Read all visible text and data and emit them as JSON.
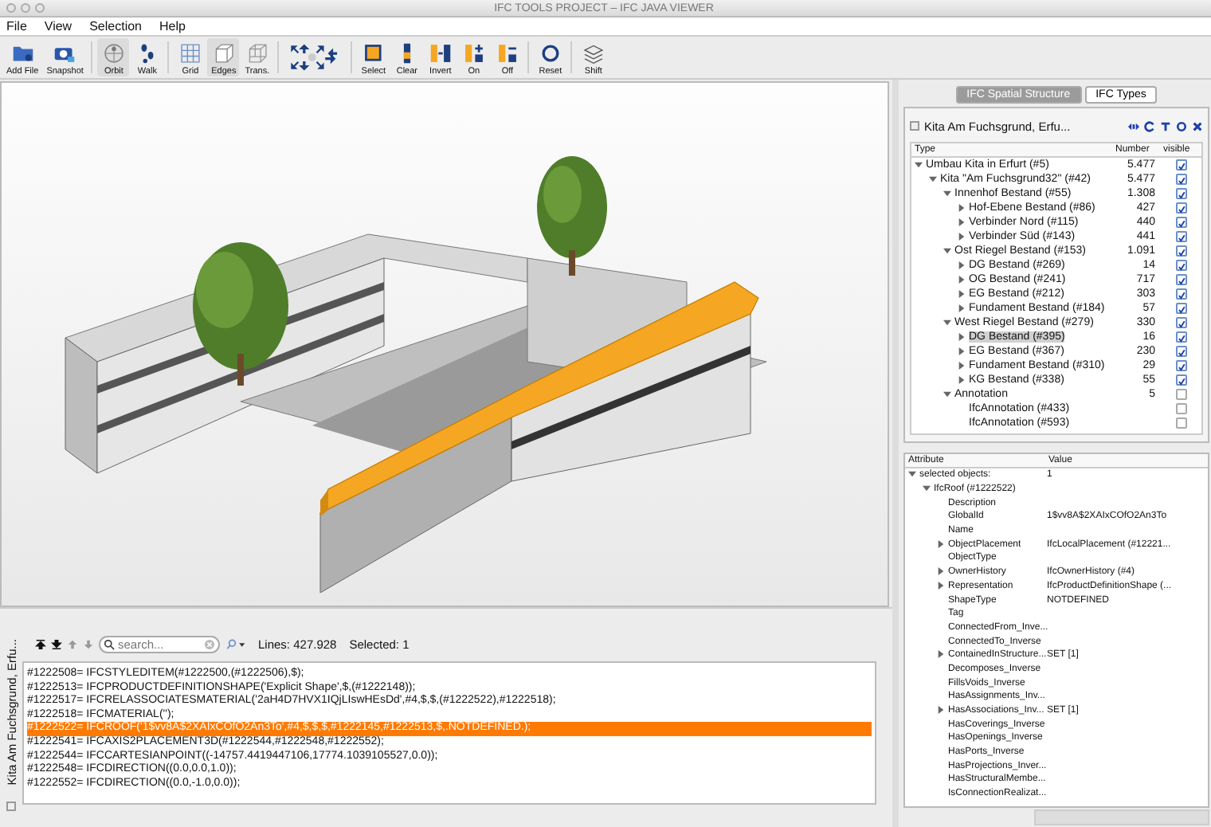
{
  "window": {
    "title": "IFC TOOLS PROJECT – IFC JAVA VIEWER"
  },
  "menu": [
    "File",
    "View",
    "Selection",
    "Help"
  ],
  "toolbar": [
    {
      "kind": "button",
      "label": "Add File"
    },
    {
      "kind": "button",
      "label": "Snapshot"
    },
    {
      "kind": "separator"
    },
    {
      "kind": "button",
      "label": "Orbit",
      "selected": true
    },
    {
      "kind": "button",
      "label": "Walk",
      "selected": false
    },
    {
      "kind": "separator"
    },
    {
      "kind": "button",
      "label": "Grid",
      "selected": false
    },
    {
      "kind": "button",
      "label": "Edges",
      "selected": true
    },
    {
      "kind": "button",
      "label": "Trans.",
      "selected": false
    },
    {
      "kind": "separator"
    },
    {
      "kind": "nav"
    },
    {
      "kind": "separator"
    },
    {
      "kind": "button",
      "label": "Select"
    },
    {
      "kind": "button",
      "label": "Clear"
    },
    {
      "kind": "button",
      "label": "Invert"
    },
    {
      "kind": "button",
      "label": "On"
    },
    {
      "kind": "button",
      "label": "Off"
    },
    {
      "kind": "separator"
    },
    {
      "kind": "button",
      "label": "Reset"
    },
    {
      "kind": "separator"
    },
    {
      "kind": "button",
      "label": "Shift"
    }
  ],
  "bottom_panel": {
    "side_tab": "Kita Am Fuchsgrund, Erfu...",
    "side_tab_checked": false,
    "search": {
      "placeholder": "search..."
    },
    "lines_label": "Lines: 427.928",
    "selected_label": "Selected: 1",
    "lines": [
      {
        "text": "#1222508= IFCSTYLEDITEM(#1222500,(#1222506),$);",
        "selected": false
      },
      {
        "text": "#1222513= IFCPRODUCTDEFINITIONSHAPE('Explicit Shape',$,(#1222148));",
        "selected": false
      },
      {
        "text": "#1222517= IFCRELASSOCIATESMATERIAL('2aH4D7HVX1IQjLIswHEsDd',#4,$,$,(#1222522),#1222518);",
        "selected": false
      },
      {
        "text": "#1222518= IFCMATERIAL('');",
        "selected": false
      },
      {
        "text": "#1222522= IFCROOF('1$vv8A$2XAIxCOfO2An3To',#4,$,$,$,#1222145,#1222513,$,.NOTDEFINED.);",
        "selected": true
      },
      {
        "text": "#1222541= IFCAXIS2PLACEMENT3D(#1222544,#1222548,#1222552);",
        "selected": false
      },
      {
        "text": "#1222544= IFCCARTESIANPOINT((-14757.4419447106,17774.1039105527,0.0));",
        "selected": false
      },
      {
        "text": "#1222548= IFCDIRECTION((0.0,0.0,1.0));",
        "selected": false
      },
      {
        "text": "#1222552= IFCDIRECTION((0.0,-1.0,0.0));",
        "selected": false
      }
    ]
  },
  "spatial_panel": {
    "tabs": [
      {
        "label": "IFC Spatial Structure",
        "selected": true
      },
      {
        "label": "IFC Types",
        "selected": false
      }
    ],
    "project": "Kita Am Fuchsgrund, Erfu...",
    "project_checked": false,
    "columns": [
      "Type",
      "Number",
      "visible"
    ],
    "tree": [
      {
        "label": "Umbau Kita in Erfurt (#5)",
        "number": "5.477",
        "visible": true,
        "expanded": true,
        "selected": false,
        "children": [
          {
            "label": "Kita \"Am Fuchsgrund32\" (#42)",
            "number": "5.477",
            "visible": true,
            "expanded": true,
            "selected": false,
            "children": [
              {
                "label": "Innenhof Bestand (#55)",
                "number": "1.308",
                "visible": true,
                "expanded": true,
                "selected": false,
                "children": [
                  {
                    "label": "Hof-Ebene Bestand (#86)",
                    "number": "427",
                    "visible": true,
                    "expanded": false,
                    "selected": false
                  },
                  {
                    "label": "Verbinder Nord (#115)",
                    "number": "440",
                    "visible": true,
                    "expanded": false,
                    "selected": false
                  },
                  {
                    "label": "Verbinder Süd (#143)",
                    "number": "441",
                    "visible": true,
                    "expanded": false,
                    "selected": false
                  }
                ]
              },
              {
                "label": "Ost Riegel Bestand (#153)",
                "number": "1.091",
                "visible": true,
                "expanded": true,
                "selected": false,
                "children": [
                  {
                    "label": "DG Bestand (#269)",
                    "number": "14",
                    "visible": true,
                    "expanded": false,
                    "selected": false
                  },
                  {
                    "label": "OG Bestand (#241)",
                    "number": "717",
                    "visible": true,
                    "expanded": false,
                    "selected": false
                  },
                  {
                    "label": "EG Bestand (#212)",
                    "number": "303",
                    "visible": true,
                    "expanded": false,
                    "selected": false
                  },
                  {
                    "label": "Fundament Bestand (#184)",
                    "number": "57",
                    "visible": true,
                    "expanded": false,
                    "selected": false
                  }
                ]
              },
              {
                "label": "West Riegel Bestand (#279)",
                "number": "330",
                "visible": true,
                "expanded": true,
                "selected": false,
                "children": [
                  {
                    "label": "DG Bestand (#395)",
                    "number": "16",
                    "visible": true,
                    "expanded": false,
                    "selected": true
                  },
                  {
                    "label": "EG Bestand (#367)",
                    "number": "230",
                    "visible": true,
                    "expanded": false,
                    "selected": false
                  },
                  {
                    "label": "Fundament Bestand (#310)",
                    "number": "29",
                    "visible": true,
                    "expanded": false,
                    "selected": false
                  },
                  {
                    "label": "KG Bestand (#338)",
                    "number": "55",
                    "visible": true,
                    "expanded": false,
                    "selected": false
                  }
                ]
              },
              {
                "label": "Annotation",
                "number": "5",
                "visible": false,
                "expanded": true,
                "selected": false,
                "children": [
                  {
                    "label": "IfcAnnotation (#433)",
                    "visible": false,
                    "selected": false
                  },
                  {
                    "label": "IfcAnnotation (#593)",
                    "visible": false,
                    "selected": false
                  }
                ]
              }
            ]
          }
        ]
      }
    ]
  },
  "attributes_panel": {
    "columns": [
      "Attribute",
      "Value"
    ],
    "tree": [
      {
        "name": "selected objects:",
        "value": "1",
        "expanded": true,
        "children": [
          {
            "name": "IfcRoof (#1222522)",
            "expanded": true,
            "children": [
              {
                "name": "Description"
              },
              {
                "name": "GlobalId",
                "value": "1$vv8A$2XAIxCOfO2An3To"
              },
              {
                "name": "Name"
              },
              {
                "name": "ObjectPlacement",
                "value": "IfcLocalPlacement (#12221...",
                "expanded": false
              },
              {
                "name": "ObjectType"
              },
              {
                "name": "OwnerHistory",
                "value": "IfcOwnerHistory (#4)",
                "expanded": false
              },
              {
                "name": "Representation",
                "value": "IfcProductDefinitionShape (...",
                "expanded": false
              },
              {
                "name": "ShapeType",
                "value": "NOTDEFINED"
              },
              {
                "name": "Tag"
              },
              {
                "name": "ConnectedFrom_Inve..."
              },
              {
                "name": "ConnectedTo_Inverse"
              },
              {
                "name": "ContainedInStructure...",
                "value": "SET [1]",
                "expanded": false
              },
              {
                "name": "Decomposes_Inverse"
              },
              {
                "name": "FillsVoids_Inverse"
              },
              {
                "name": "HasAssignments_Inv..."
              },
              {
                "name": "HasAssociations_Inv...",
                "value": "SET [1]",
                "expanded": false
              },
              {
                "name": "HasCoverings_Inverse"
              },
              {
                "name": "HasOpenings_Inverse"
              },
              {
                "name": "HasPorts_Inverse"
              },
              {
                "name": "HasProjections_Inver..."
              },
              {
                "name": "HasStructuralMembe..."
              },
              {
                "name": "IsConnectionRealizat..."
              }
            ]
          }
        ]
      }
    ]
  }
}
